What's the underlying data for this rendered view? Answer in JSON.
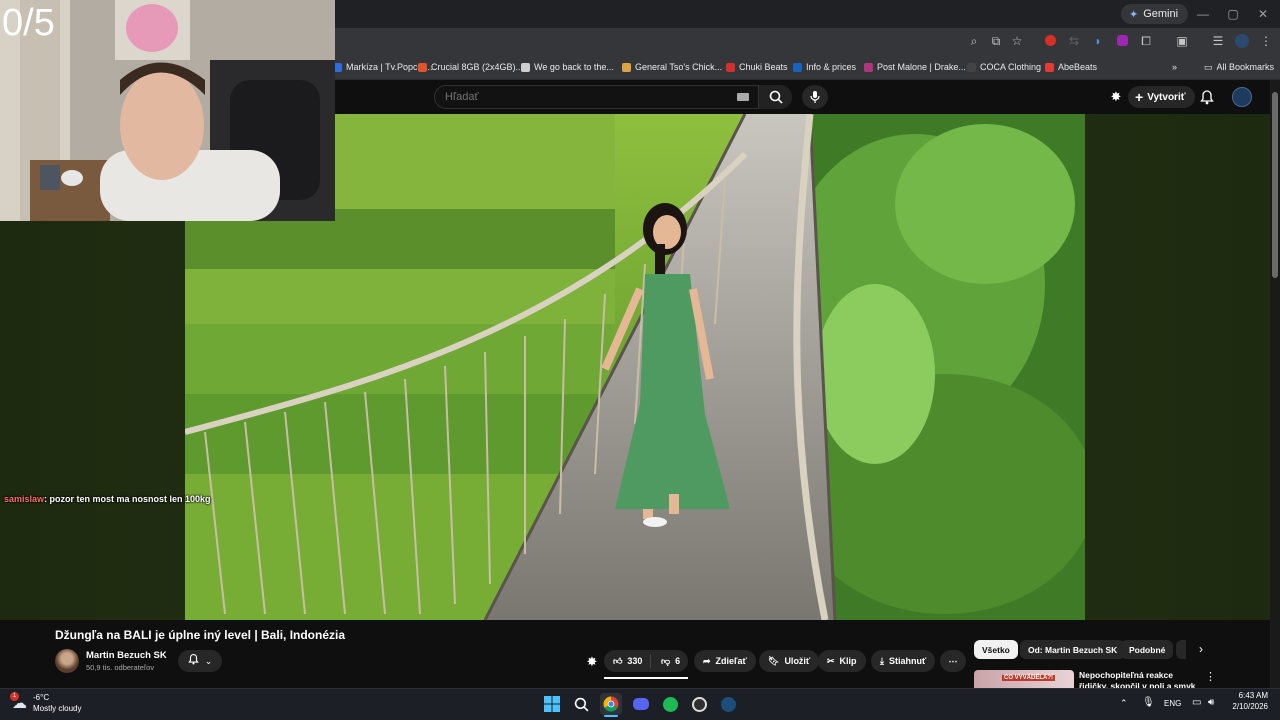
{
  "overlay": {
    "counter": "0/5",
    "chat": {
      "user": "samislaw",
      "message": ": pozor ten most ma nosnost len 100kg"
    }
  },
  "browser": {
    "gemini_label": "Gemini",
    "bookmarks": [
      {
        "label": "Markíza | Tv.Popcor...",
        "color": "#2d6cdf"
      },
      {
        "label": "Crucial 8GB (2x4GB)...",
        "color": "#e0532b"
      },
      {
        "label": "We go back to the...",
        "color": "#cfcfcf"
      },
      {
        "label": "General Tso's Chick...",
        "color": "#d9a441"
      },
      {
        "label": "Chuki Beats",
        "color": "#d32f2f"
      },
      {
        "label": "Info & prices",
        "color": "#1565c0"
      },
      {
        "label": "Post Malone | Drake...",
        "color": "#b0357a"
      },
      {
        "label": "COCA Clothing",
        "color": "#444444"
      },
      {
        "label": "AbeBeats",
        "color": "#e53935"
      }
    ],
    "all_bookmarks": "All Bookmarks"
  },
  "youtube": {
    "search_placeholder": "Hľadať",
    "create_label": "Vytvoriť",
    "video_title": "Džungľa na BALI je úplne iný level | Bali, Indonézia",
    "channel_name": "Martin Bezuch SK",
    "subscribers": "50,9 tis. odberateľov",
    "likes": "330",
    "dislikes": "6",
    "share_label": "Zdieľať",
    "save_label": "Uložiť",
    "clip_label": "Klip",
    "download_label": "Stiahnuť",
    "chips": [
      "Všetko",
      "Od: Martin Bezuch SK",
      "Podobné"
    ],
    "related": {
      "title": "Nepochopiteľná reakce řidičky, skončil v poli a smyk na ledový",
      "thumb_text": "CO VYVÁDĚLA?!"
    }
  },
  "taskbar": {
    "temp": "-6°C",
    "condition": "Mostly cloudy",
    "lang": "ENG",
    "time": "6:43 AM",
    "date": "2/10/2026",
    "notif_badge": "1"
  }
}
